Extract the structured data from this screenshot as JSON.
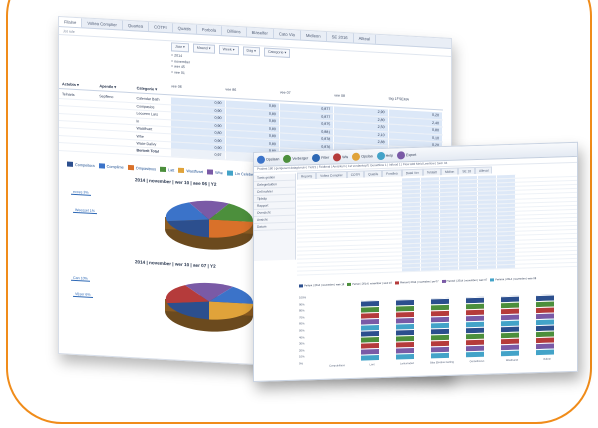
{
  "colors": {
    "frame": "#f08c1a",
    "accent_blue": "#2d68b5",
    "cell_fill": "#dce8f8"
  },
  "back_window": {
    "tabs": [
      "Fllalne",
      "Voltea Complier",
      "Quartea",
      "COTFI",
      "Quattis",
      "Forbola",
      "Dillions",
      "Blaselfer",
      "Cato Via",
      "Midleon",
      "SE 2016",
      "Allteal"
    ],
    "sub_label": "Jot rule",
    "filters": [
      "Jaar ▾",
      "Maand ▾",
      "Week ▾",
      "Dag ▾",
      "Categorie ▾"
    ],
    "pivot_header_lines": [
      "= 2014",
      "= november",
      "= wer 45",
      "= vee 01"
    ],
    "col_headers": [
      "vee 06",
      "vee 86",
      "vee 07",
      "vee 08",
      "tag 1FSEMA"
    ],
    "row_headers": [
      "Actebts",
      "Apentle",
      "Categorie"
    ],
    "rows": [
      {
        "a": "Telnarts",
        "b": "Sepfleno",
        "c": "Calendar Bath",
        "v": [
          "0,90",
          "0,80",
          "0,877",
          "2,90",
          "0,20"
        ]
      },
      {
        "a": "",
        "b": "",
        "c": "Compasios",
        "v": [
          "0,90",
          "0,80",
          "0,877",
          "2,80",
          "2,40"
        ]
      },
      {
        "a": "",
        "b": "",
        "c": "Lecceen Lars",
        "v": [
          "0,90",
          "0,80",
          "0,875",
          "2,50",
          "0,80"
        ]
      },
      {
        "a": "",
        "b": "",
        "c": "ln",
        "v": [
          "0,90",
          "0,80",
          "0,881",
          "2,10",
          "0,10"
        ]
      },
      {
        "a": "",
        "b": "",
        "c": "Wastfivart",
        "v": [
          "0,80",
          "0,80",
          "0,878",
          "2,88",
          "0,20"
        ]
      },
      {
        "a": "",
        "b": "",
        "c": "Whe",
        "v": [
          "0,90",
          "0,80",
          "0,876",
          "2,80",
          "0,20"
        ]
      },
      {
        "a": "",
        "b": "",
        "c": "Wase Dalivy",
        "v": [
          "0,90",
          "0,80",
          "0,877",
          "2,11",
          "0,20"
        ]
      }
    ],
    "total_row": {
      "label": "Bertorit Total",
      "v": [
        "0,97",
        "0,80",
        "0,876",
        "2,17",
        "0,20"
      ]
    },
    "pie_legend": [
      {
        "label": "Compeitora",
        "color": "#2c4f8e"
      },
      {
        "label": "Complime",
        "color": "#3b73c9"
      },
      {
        "label": "Ompasitnos",
        "color": "#d9712a"
      },
      {
        "label": "Latt",
        "color": "#4c8f3c"
      },
      {
        "label": "Wastfivart",
        "color": "#e0a33a"
      },
      {
        "label": "Whe",
        "color": "#7a5aa6"
      },
      {
        "label": "Lin Celebe",
        "color": "#43a3c8"
      }
    ],
    "pie1": {
      "title": "2014 | november | wer 10 | aee 06 | Y2",
      "callouts_left": [
        "ecces 3%",
        "Weessel 1%"
      ],
      "callouts_right": [
        "Blaovoras 18%",
        "Samplenat 9%",
        "Ohso Vaha 1%",
        "Lellsirs 1%"
      ]
    },
    "pie2": {
      "title": "2014 | november | wer 10 | aer 07 | Y2",
      "callouts_left": [
        "Can 10%",
        "VI|ser 6%"
      ],
      "callouts_right": [
        "Complene 7%",
        "Conplendent 7%",
        "Dodheroa 3%",
        "Blire 3%"
      ]
    }
  },
  "front_window": {
    "toolbar": [
      "Opslaan",
      "Verberger",
      "Filter",
      "Wis",
      "Opslaa",
      "Help",
      "Export"
    ],
    "path_text": "Prodest 180 | gerigesent dataglovuiv | Tiot21 | Feldtmal | Amisikum | 1st verdankopf | Genelfilow 1 | Inflood 1 | Flow Abtl Meld Leerllow | Sem 04",
    "tabs": [
      "Reports",
      "Voltea Complier",
      "COTFI",
      "Quatils",
      "Fondlea",
      "Datal Ver",
      "Teldaitt",
      "Midion",
      "SE 18",
      "Alleval"
    ],
    "left_panel": [
      "Toets gedien",
      "Gelegmtalden",
      "Cell nalvier",
      "Tijdstip",
      "Rapport",
      "Overzicht",
      "Ansicht",
      "Datum"
    ],
    "bar_legend": [
      {
        "label": "Pempa | 2014 | november | wee 18",
        "color": "#2c4f8e"
      },
      {
        "label": "Pemar | 2014 | november | wee 10",
        "color": "#4c8f3c"
      },
      {
        "label": "Plensal | 2014 | november | pe 07",
        "color": "#b53b3b"
      },
      {
        "label": "Plennel | 2014 | november | wee 07",
        "color": "#7a5aa6"
      },
      {
        "label": "Pemma | 2014 | november | wee 08",
        "color": "#43a3c8"
      }
    ],
    "y_ticks": [
      "100%",
      "90%",
      "80%",
      "70%",
      "60%",
      "50%",
      "40%",
      "30%",
      "20%",
      "10%",
      "0%"
    ],
    "categories": [
      "Compubitians",
      "Lavt",
      "Lemonaded",
      "Blas Elestive Gelting",
      "Gemelbiurus",
      "Wasthanet",
      "Vidieer"
    ]
  }
}
